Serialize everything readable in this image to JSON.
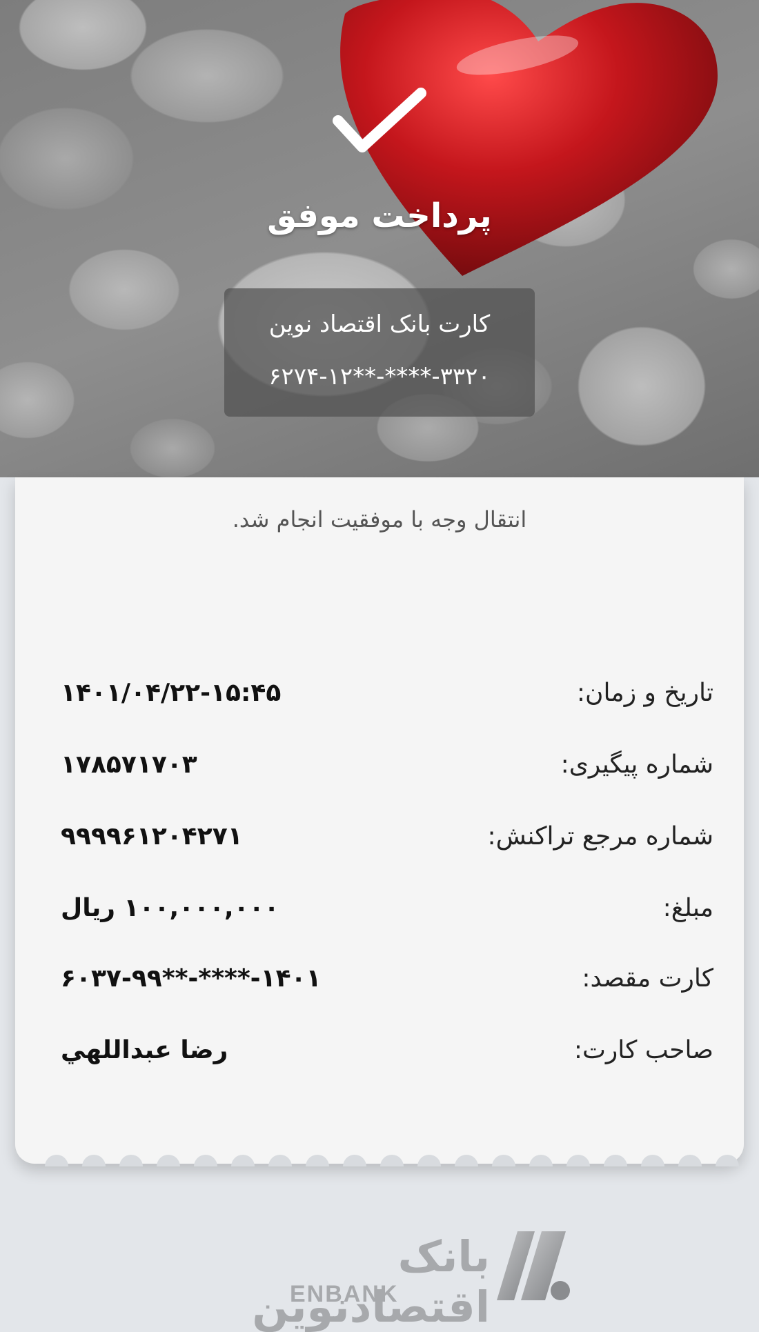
{
  "hero": {
    "title": "پرداخت موفق",
    "source_card": {
      "bank_name": "کارت بانک اقتصاد نوین",
      "number": "۶۲۷۴-۱۲**-****-۳۳۲۰"
    }
  },
  "receipt": {
    "status_message": "انتقال وجه با موفقیت انجام شد.",
    "rows": [
      {
        "label": "تاریخ و زمان:",
        "value": "۱۴۰۱/۰۴/۲۲-۱۵:۴۵"
      },
      {
        "label": "شماره پیگیری:",
        "value": "۱۷۸۵۷۱۷۰۳"
      },
      {
        "label": "شماره مرجع تراکنش:",
        "value": "۹۹۹۹۶۱۲۰۴۲۷۱"
      },
      {
        "label": "مبلغ:",
        "value": "۱۰۰,۰۰۰,۰۰۰ ریال"
      },
      {
        "label": "کارت مقصد:",
        "value": "۶۰۳۷-۹۹**-****-۱۴۰۱"
      },
      {
        "label": "صاحب کارت:",
        "value": "رضا عبداللهي"
      }
    ]
  },
  "footer": {
    "logo_fa": "بانک اقتصادنوین",
    "logo_en": "ENBANK"
  },
  "colors": {
    "background": "#e3e6ea",
    "receipt": "#f5f5f5",
    "heart": "#c4161c",
    "logo": "#a7a9ac"
  },
  "icons": [
    "checkmark-icon",
    "heart-image",
    "enbank-logo-icon"
  ]
}
